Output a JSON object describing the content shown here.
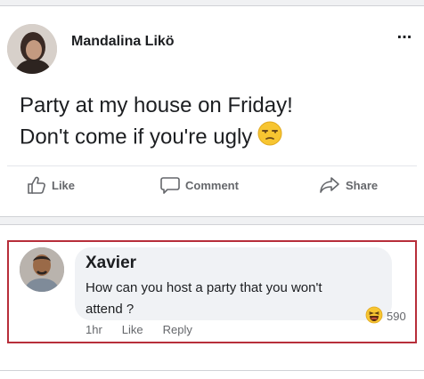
{
  "post": {
    "author": "Mandalina Likö",
    "more_label": "...",
    "text_line1": "Party at my house on Friday!",
    "text_line2": "Don't come if you're ugly",
    "actions": {
      "like": "Like",
      "comment": "Comment",
      "share": "Share"
    }
  },
  "comment": {
    "author": "Xavier",
    "text": "How can you host a party that you won't attend ?",
    "time": "1hr",
    "like": "Like",
    "reply": "Reply",
    "reaction_count": "590"
  },
  "colors": {
    "highlight_border": "#b72e3a",
    "bubble_bg": "#f0f2f5"
  },
  "icons": [
    "avatar",
    "more-icon",
    "unamused-emoji",
    "like-icon",
    "comment-icon",
    "share-icon",
    "haha-reaction-icon"
  ]
}
